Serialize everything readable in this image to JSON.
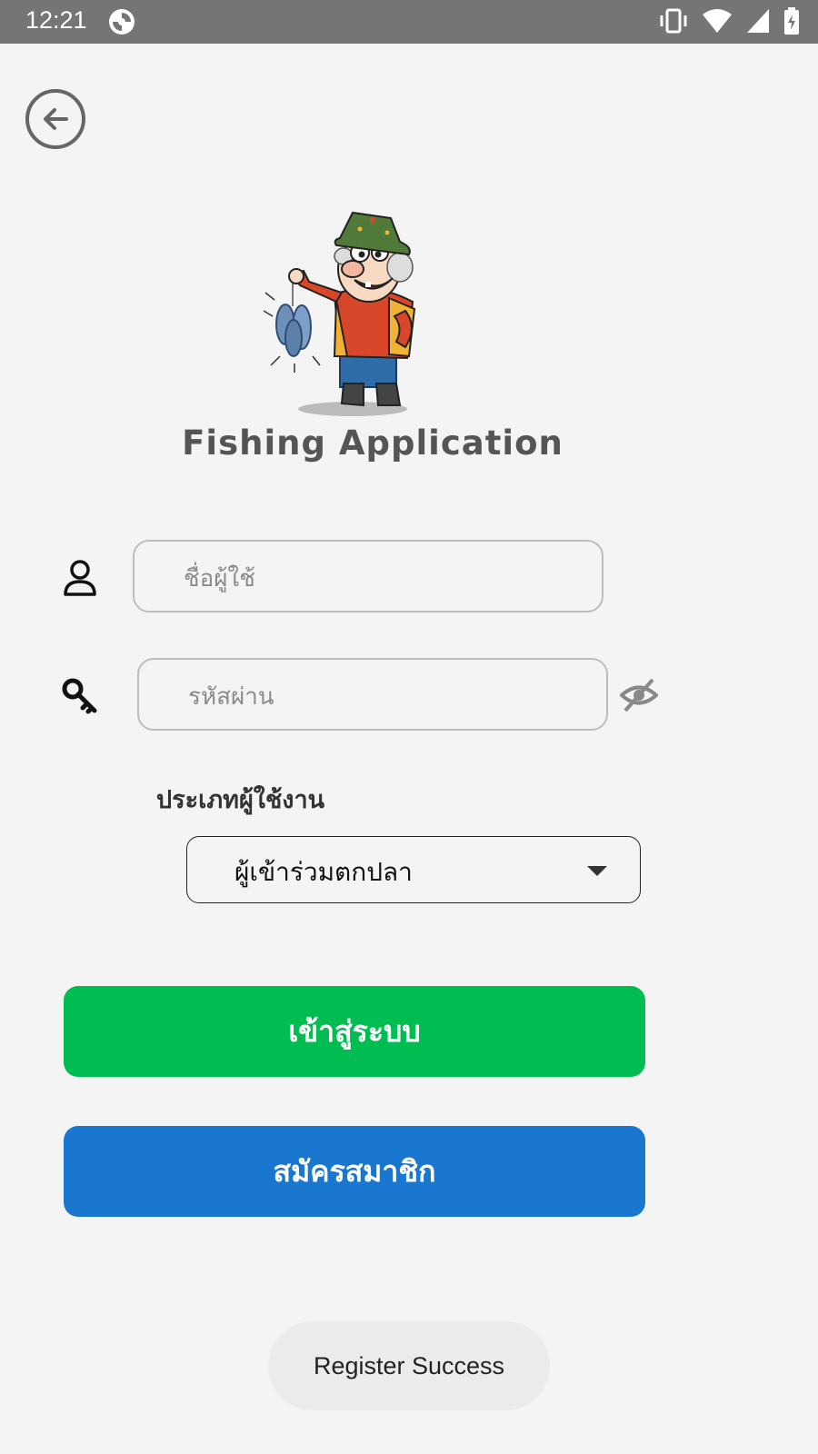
{
  "status_bar": {
    "time": "12:21"
  },
  "header": {
    "back_icon": "arrow-left-circle-icon"
  },
  "brand": {
    "title": "Fishing Application",
    "mascot": "fisherman-mascot-illustration"
  },
  "form": {
    "username": {
      "icon": "user-icon",
      "placeholder": "ชื่อผู้ใช้",
      "value": ""
    },
    "password": {
      "icon": "key-icon",
      "placeholder": "รหัสผ่าน",
      "value": "",
      "visibility_icon": "eye-off-icon"
    },
    "user_type": {
      "label": "ประเภทผู้ใช้งาน",
      "selected": "ผู้เข้าร่วมตกปลา"
    }
  },
  "buttons": {
    "login": "เข้าสู่ระบบ",
    "register": "สมัครสมาชิก"
  },
  "toast": {
    "message": "Register Success"
  },
  "colors": {
    "login_button": "#00bd52",
    "register_button": "#1a77d0",
    "background": "#f4f4f4",
    "status_bar": "#757575"
  }
}
